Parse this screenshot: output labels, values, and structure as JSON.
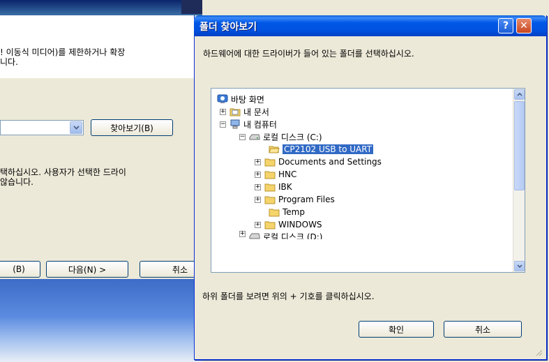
{
  "background_wizard": {
    "text_line1": "! 이동식 미디어)를 제한하거나 확장",
    "text_line2": "니다.",
    "browse_button": "찾아보기(B)",
    "text_line3": "택하십시오. 사용자가 선택한 드라이",
    "text_line4": "않습니다.",
    "back_button": "(B)",
    "next_button": "다음(N) >",
    "cancel_button": "취소"
  },
  "dialog": {
    "title": "폴더 찾아보기",
    "help_glyph": "?",
    "close_glyph": "✕",
    "instruction": "하드웨어에 대한 드라이버가 들어 있는 폴더를 선택하십시오.",
    "hint": "하위 폴더를 보려면 위의 + 기호를 클릭하십시오.",
    "ok_button": "확인",
    "cancel_button": "취소"
  },
  "tree": {
    "desktop": "바탕 화면",
    "my_documents": "내 문서",
    "my_computer": "내 컴퓨터",
    "local_disk_c": "로컬 디스크 (C:)",
    "folders": [
      "CP2102 USB to UART",
      "Documents and Settings",
      "HNC",
      "IBK",
      "Program Files",
      "Temp",
      "WINDOWS"
    ],
    "local_disk_d": "로컬 디스크 (D:)",
    "plus": "+",
    "minus": "−",
    "selected": "CP2102 USB to UART"
  },
  "colors": {
    "selection": "#316ac5",
    "titlebar": "#0058e6",
    "folder": "#f5d46c"
  }
}
